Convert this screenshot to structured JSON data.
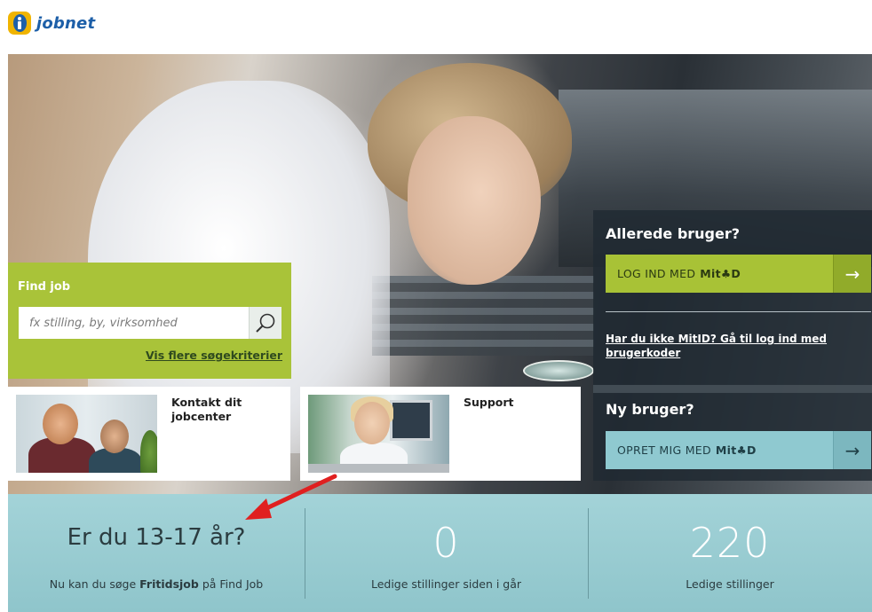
{
  "header": {
    "brand": "jobnet",
    "logo_icon": "jobnet-info-icon"
  },
  "find_job": {
    "title": "Find job",
    "search_placeholder": "fx stilling, by, virksomhed",
    "search_value": "",
    "search_icon": "search-icon",
    "more_criteria": "Vis flere søgekriterier"
  },
  "cards": [
    {
      "title": "Kontakt dit jobcenter",
      "image": "people-meeting-photo"
    },
    {
      "title": "Support",
      "image": "support-agent-photo"
    }
  ],
  "existing_user": {
    "title": "Allerede bruger?",
    "login_prefix": "LOG IND MED",
    "login_brand": "Mit♣D",
    "alt_login_link": "Har du ikke MitID? Gå til log ind med brugerkoder"
  },
  "new_user": {
    "title": "Ny bruger?",
    "create_prefix": "OPRET MIG MED",
    "create_brand": "Mit♣D"
  },
  "stats": {
    "teen": {
      "headline": "Er du 13-17 år?",
      "text_before": "Nu kan du søge ",
      "text_bold": "Fritidsjob",
      "text_after": " på Find Job"
    },
    "since_yesterday": {
      "value": "0",
      "label": "Ledige stillinger siden i går"
    },
    "total": {
      "value": "220",
      "label": "Ledige stillinger"
    }
  },
  "colors": {
    "green": "#a9c339",
    "teal": "#8fc9d0",
    "dark_panel": "#202a32",
    "brand_blue": "#1d5fa8",
    "brand_yellow": "#f0b400",
    "annotation_red": "#e02020"
  }
}
